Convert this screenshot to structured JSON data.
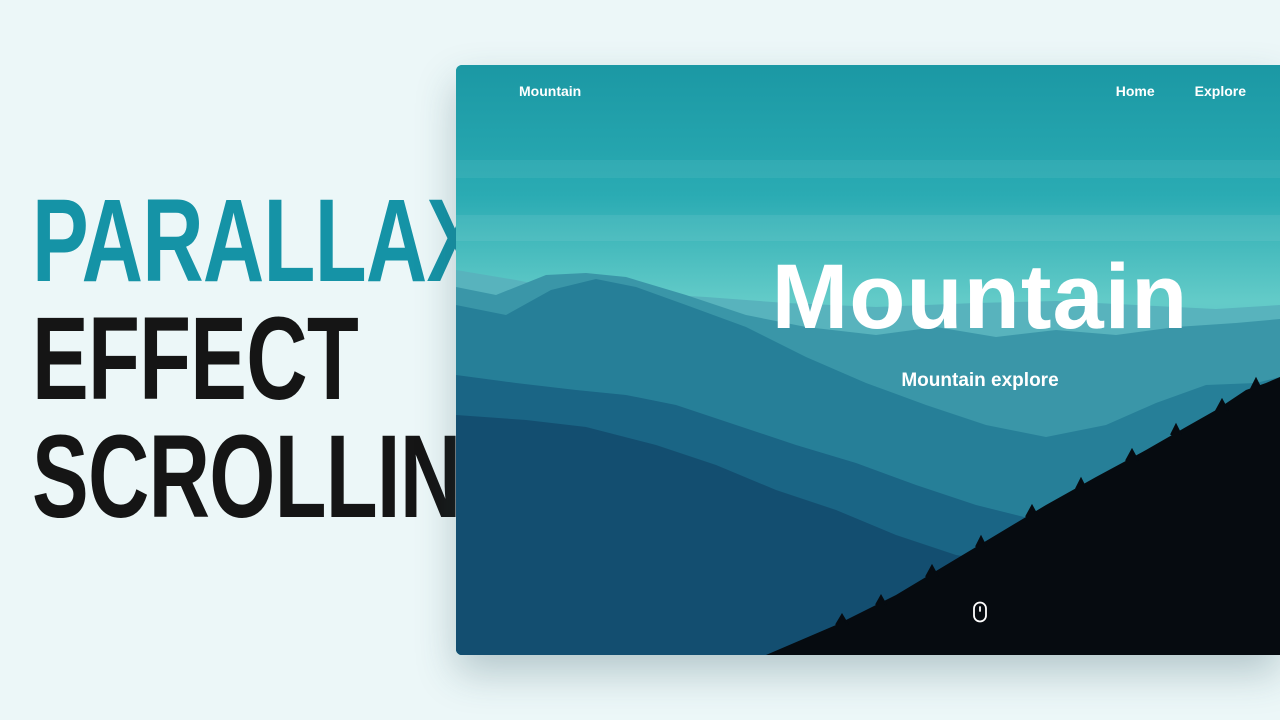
{
  "headline": {
    "line1": "PARALLAX",
    "line2": "EFFECT",
    "line3": "SCROLLING"
  },
  "site": {
    "brand": "Mountain",
    "nav": [
      {
        "label": "Home"
      },
      {
        "label": "Explore"
      }
    ],
    "hero_title": "Mountain",
    "hero_subtitle": "Mountain explore",
    "scroll_icon": "mouse-scroll-icon"
  },
  "colors": {
    "accent": "#1593a6",
    "headline_dark": "#151515",
    "page_background": "#ecf7f8",
    "sky_top": "#1a9aa6",
    "sky_glow": "#6fd0cc"
  }
}
